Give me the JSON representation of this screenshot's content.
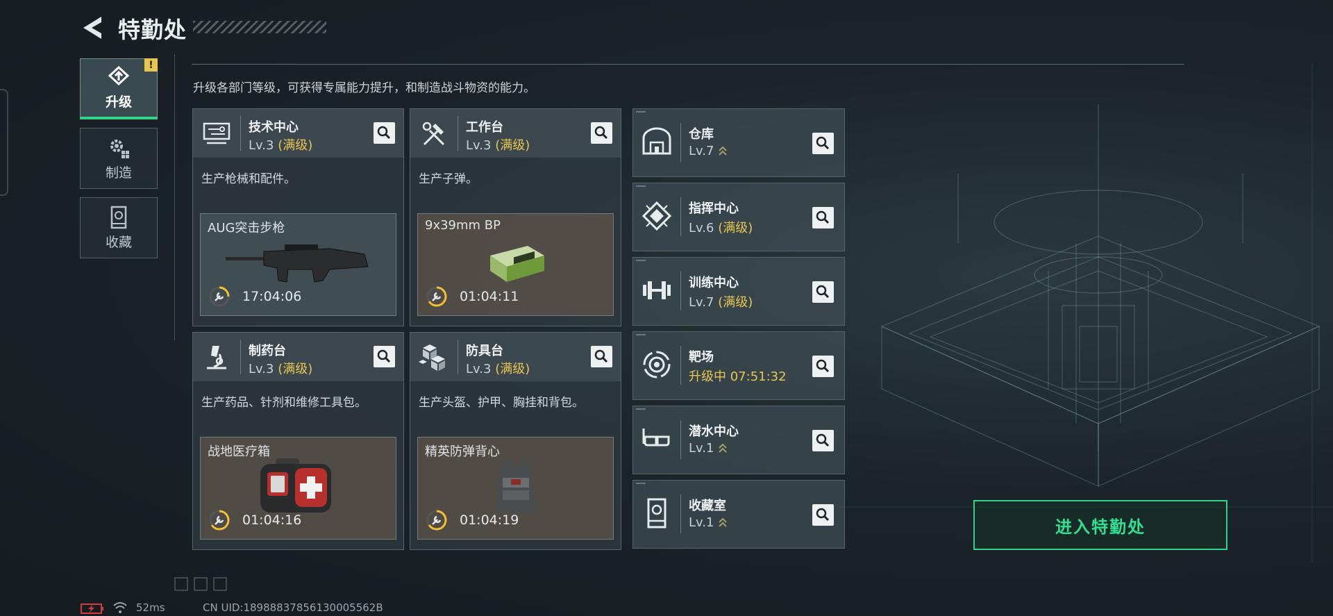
{
  "header": {
    "title": "特勤处"
  },
  "tabs": [
    {
      "label": "升级",
      "active": true,
      "alert": "!"
    },
    {
      "label": "制造",
      "active": false
    },
    {
      "label": "收藏",
      "active": false
    }
  ],
  "description": "升级各部门等级，可获得专属能力提升，和制造战斗物资的能力。",
  "cards": [
    {
      "name": "技术中心",
      "level": "Lv.3",
      "max": "(满级)",
      "desc": "生产枪械和配件。",
      "product": "AUG突击步枪",
      "timer": "17:04:06"
    },
    {
      "name": "工作台",
      "level": "Lv.3",
      "max": "(满级)",
      "desc": "生产子弹。",
      "product": "9x39mm BP",
      "timer": "01:04:11"
    },
    {
      "name": "制药台",
      "level": "Lv.3",
      "max": "(满级)",
      "desc": "生产药品、针剂和维修工具包。",
      "product": "战地医疗箱",
      "timer": "01:04:16"
    },
    {
      "name": "防具台",
      "level": "Lv.3",
      "max": "(满级)",
      "desc": "生产头盔、护甲、胸挂和背包。",
      "product": "精英防弹背心",
      "timer": "01:04:19"
    }
  ],
  "rows": [
    {
      "name": "仓库",
      "level": "Lv.7",
      "max": ""
    },
    {
      "name": "指挥中心",
      "level": "Lv.6",
      "max": "(满级)"
    },
    {
      "name": "训练中心",
      "level": "Lv.7",
      "max": "(满级)"
    },
    {
      "name": "靶场",
      "level": "升级中 07:51:32",
      "max": ""
    },
    {
      "name": "潜水中心",
      "level": "Lv.1",
      "max": ""
    },
    {
      "name": "收藏室",
      "level": "Lv.1",
      "max": ""
    }
  ],
  "enter_button": "进入特勤处",
  "status": {
    "ping": "52ms",
    "uid": "CN UID:18988837856130005562B"
  },
  "colors": {
    "accent": "#2fd689",
    "max_level": "#e9c64f"
  }
}
